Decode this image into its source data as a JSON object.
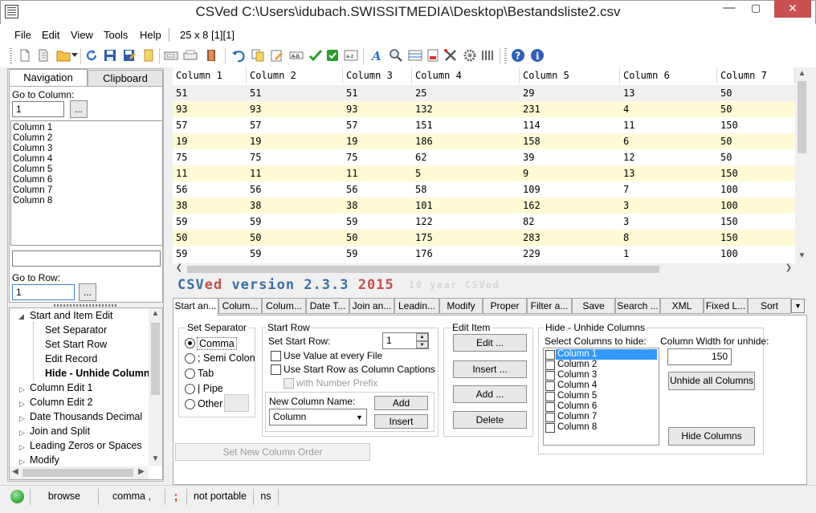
{
  "window": {
    "title": "CSVed C:\\Users\\idubach.SWISSITMEDIA\\Desktop\\Bestandsliste2.csv",
    "minimize_label": "—",
    "maximize_label": "▢",
    "close_label": "✕"
  },
  "menu": {
    "items": [
      "File",
      "Edit",
      "View",
      "Tools",
      "Help"
    ],
    "grid_info": "25 x 8 [1][1]"
  },
  "toolbar": {
    "icons": [
      "new-file-icon",
      "open-file-icon",
      "open-folder-icon",
      "dropdown-arrow-icon",
      "reload-icon",
      "save-icon",
      "save-as-icon",
      "bookmark-icon",
      "export-icon",
      "print-icon",
      "exit-icon",
      "undo-icon",
      "copy-icon",
      "edit-icon",
      "rename-icon",
      "accept-icon",
      "checkbox-icon",
      "sort-icon",
      "font-icon",
      "search-icon",
      "columns-icon",
      "page-icon",
      "tools-icon",
      "settings-icon",
      "grid-icon",
      "help-icon",
      "info-icon"
    ]
  },
  "left_panel": {
    "tabs": [
      "Navigation",
      "Clipboard"
    ],
    "goto_column_label": "Go to Column:",
    "goto_column_value": "1",
    "goto_button": "...",
    "columns": [
      "Column 1",
      "Column 2",
      "Column 3",
      "Column 4",
      "Column 5",
      "Column 6",
      "Column 7",
      "Column 8"
    ],
    "goto_row_label": "Go to Row:",
    "goto_row_value": "1",
    "tree": [
      {
        "label": "Start and Item Edit",
        "level": 0,
        "expanded": true
      },
      {
        "label": "Set Separator",
        "level": 1
      },
      {
        "label": "Set Start Row",
        "level": 1
      },
      {
        "label": "Edit Record",
        "level": 1
      },
      {
        "label": "Hide - Unhide Columns",
        "level": 1,
        "bold": true
      },
      {
        "label": "Column Edit 1",
        "level": 0
      },
      {
        "label": "Column Edit 2",
        "level": 0
      },
      {
        "label": "Date Thousands Decimal",
        "level": 0
      },
      {
        "label": "Join and Split",
        "level": 0
      },
      {
        "label": "Leading Zeros or Spaces",
        "level": 0
      },
      {
        "label": "Modify",
        "level": 0
      }
    ]
  },
  "grid": {
    "headers": [
      "Column 1",
      "Column 2",
      "Column 3",
      "Column 4",
      "Column 5",
      "Column 6",
      "Column 7"
    ],
    "rows": [
      [
        "51",
        "51",
        "51",
        "25",
        "29",
        "13",
        "50"
      ],
      [
        "93",
        "93",
        "93",
        "132",
        "231",
        "4",
        "50"
      ],
      [
        "57",
        "57",
        "57",
        "151",
        "114",
        "11",
        "150"
      ],
      [
        "19",
        "19",
        "19",
        "186",
        "158",
        "6",
        "50"
      ],
      [
        "75",
        "75",
        "75",
        "62",
        "39",
        "12",
        "50"
      ],
      [
        "11",
        "11",
        "11",
        "5",
        "9",
        "13",
        "150"
      ],
      [
        "56",
        "56",
        "56",
        "58",
        "109",
        "7",
        "100"
      ],
      [
        "38",
        "38",
        "38",
        "101",
        "162",
        "3",
        "100"
      ],
      [
        "59",
        "59",
        "59",
        "122",
        "82",
        "3",
        "150"
      ],
      [
        "50",
        "50",
        "50",
        "175",
        "283",
        "8",
        "150"
      ],
      [
        "59",
        "59",
        "59",
        "176",
        "229",
        "1",
        "100"
      ]
    ],
    "zebra_color": "#fffbd6",
    "selected_row_color": "#f0f0f0"
  },
  "banner": {
    "csv": "CSV",
    "ed": "ed",
    "version": " version 2.3.3 ",
    "year": "2015",
    "tagline": "10 year CSVed",
    "color_blue": "#3a6ea5",
    "color_red": "#c0504d"
  },
  "bottom_tabs": [
    "Start an...",
    "Colum...",
    "Colum...",
    "Date T...",
    "Join an...",
    "Leadin...",
    "Modify",
    "Proper",
    "Filter a...",
    "Save",
    "Search ...",
    "XML",
    "Fixed L...",
    "Sort"
  ],
  "set_separator": {
    "title": "Set Separator",
    "options": [
      "Comma",
      "; Semi Colon",
      "Tab",
      "| Pipe",
      "Other"
    ],
    "selected": "Comma"
  },
  "start_row": {
    "title": "Start Row",
    "set_start_row_label": "Set Start Row:",
    "set_start_row_value": "1",
    "use_value_label": "Use Value at every File",
    "use_captions_label": "Use Start Row as Column Captions",
    "number_prefix_label": "with Number Prefix",
    "new_column_label": "New Column Name:",
    "new_column_value": "Column",
    "add_button": "Add",
    "insert_button": "Insert"
  },
  "edit_item": {
    "title": "Edit Item",
    "buttons": [
      "Edit ...",
      "Insert ...",
      "Add ...",
      "Delete"
    ]
  },
  "hide_columns": {
    "title": "Hide - Unhide Columns",
    "select_label": "Select Columns to hide:",
    "columns": [
      "Column 1",
      "Column 2",
      "Column 3",
      "Column 4",
      "Column 5",
      "Column 6",
      "Column 7",
      "Column 8"
    ],
    "width_label": "Column Width for unhide:",
    "width_value": "150",
    "unhide_all_button": "Unhide all Columns",
    "hide_button": "Hide Columns"
  },
  "set_column_order_button": "Set New Column Order",
  "status": {
    "mode": "browse",
    "separator": "comma ,",
    "sep_char": ";",
    "portable": "not portable",
    "ns": "ns",
    "indicator_color": "#3cb043"
  }
}
